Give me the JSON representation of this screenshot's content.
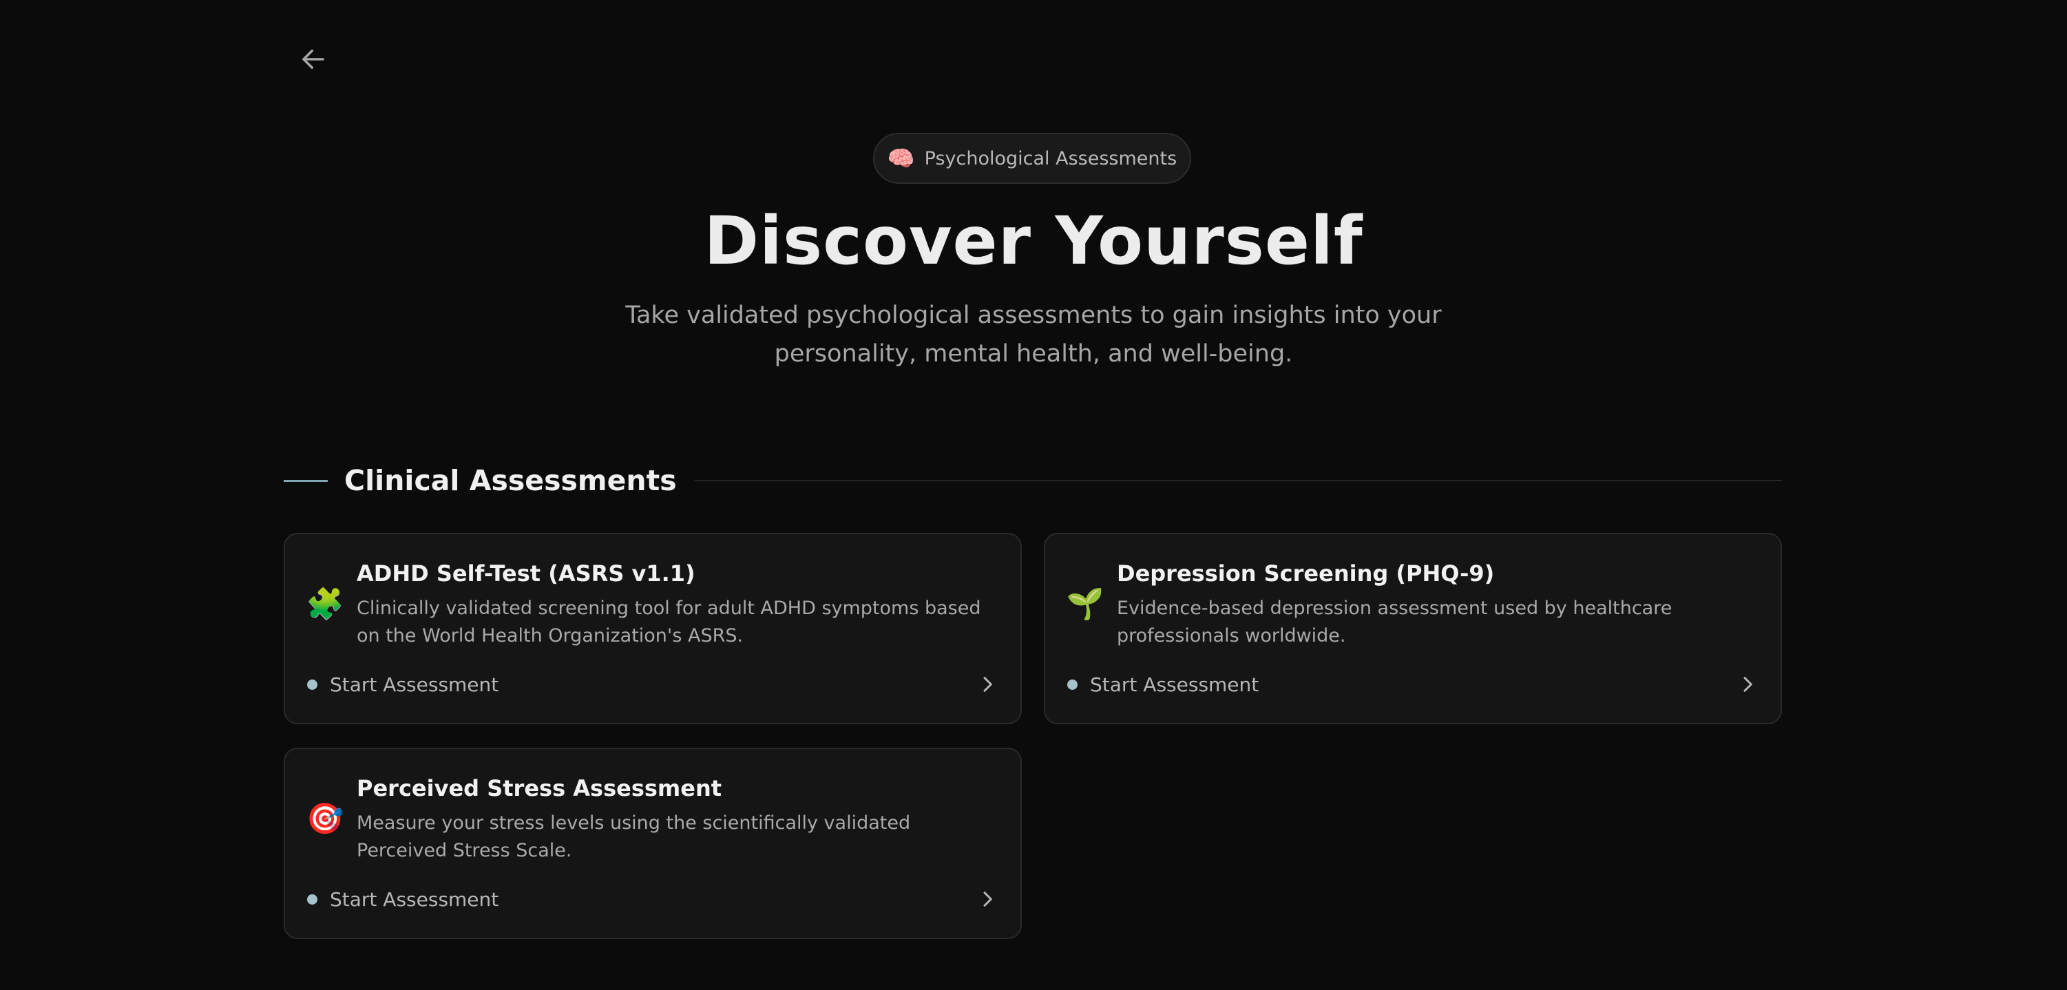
{
  "nav": {
    "back_icon": "arrow-left-icon"
  },
  "hero": {
    "badge_icon": "🧠",
    "badge_label": "Psychological Assessments",
    "title": "Discover Yourself",
    "subtitle": "Take validated psychological assessments to gain insights into your personality, mental health, and well-being."
  },
  "section": {
    "title": "Clinical Assessments"
  },
  "cards": [
    {
      "icon": "🧩",
      "icon_name": "puzzle-piece-icon",
      "title": "ADHD Self-Test (ASRS v1.1)",
      "description": "Clinically validated screening tool for adult ADHD symptoms based on the World Health Organization's ASRS.",
      "cta": "Start Assessment"
    },
    {
      "icon": "🌱",
      "icon_name": "seedling-icon",
      "title": "Depression Screening (PHQ-9)",
      "description": "Evidence-based depression assessment used by healthcare professionals worldwide.",
      "cta": "Start Assessment"
    },
    {
      "icon": "🎯",
      "icon_name": "target-icon",
      "title": "Perceived Stress Assessment",
      "description": "Measure your stress levels using the scientifically validated Perceived Stress Scale.",
      "cta": "Start Assessment"
    }
  ],
  "colors": {
    "background": "#0b0b0b",
    "card_background": "#151515",
    "accent": "#7fa6b3",
    "status_dot": "#a6c3cc"
  }
}
